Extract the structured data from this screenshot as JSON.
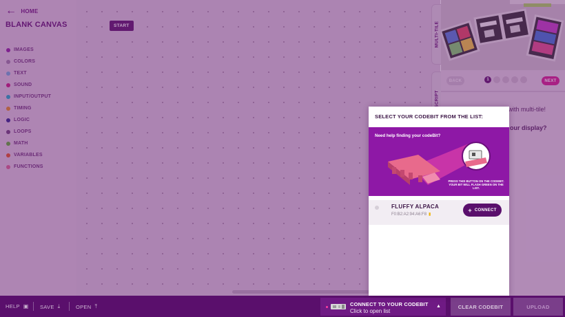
{
  "sidebar": {
    "home_label": "HOME",
    "canvas_title": "BLANK CANVAS",
    "categories": [
      {
        "label": "IMAGES",
        "color": "#8c1aa0"
      },
      {
        "label": "COLORS",
        "color": "#9a7aa5"
      },
      {
        "label": "TEXT",
        "color": "#6fa7d8"
      },
      {
        "label": "SOUND",
        "color": "#c4137e"
      },
      {
        "label": "INPUT/OUTPUT",
        "color": "#1aa6c4"
      },
      {
        "label": "TIMING",
        "color": "#e08a1e"
      },
      {
        "label": "LOGIC",
        "color": "#2a1f8a"
      },
      {
        "label": "LOOPS",
        "color": "#6b3f7a"
      },
      {
        "label": "MATH",
        "color": "#5aa830"
      },
      {
        "label": "VARIABLES",
        "color": "#e05020"
      },
      {
        "label": "FUNCTIONS",
        "color": "#d86090"
      }
    ]
  },
  "workspace": {
    "start_block": "START"
  },
  "side_tabs": {
    "multi_tile": "MULTI-TILE",
    "script": "SCRIPT"
  },
  "tutorial": {
    "back_label": "BACK",
    "next_label": "NEXT",
    "current_step": "1",
    "line1": "Create a giant display with multi-tile!",
    "line2": "our display?"
  },
  "modal": {
    "title": "SELECT YOUR CODEBIT FROM THE LIST:",
    "banner_help": "Need help finding your codeBit?",
    "banner_caption": "PRESS THIS BUTTON ON THE CODEBIT. YOUR BIT WILL FLASH GREEN ON THE LIST.",
    "devices": [
      {
        "name": "FLUFFY ALPACA",
        "address": "F0:B2:A2:94:A6:F8",
        "connect_label": "CONNECT"
      }
    ]
  },
  "bottombar": {
    "help": "HELP",
    "save": "SAVE",
    "open": "OPEN",
    "connect_title": "CONNECT TO YOUR CODEBIT",
    "connect_sub": "Click to open list",
    "clear_label": "CLEAR CODEBIT",
    "upload_label": "UPLOAD"
  },
  "colors": {
    "brand_purple": "#5a0f6c",
    "accent_pink": "#d21a8e",
    "banner_purple": "#8e18a6"
  }
}
